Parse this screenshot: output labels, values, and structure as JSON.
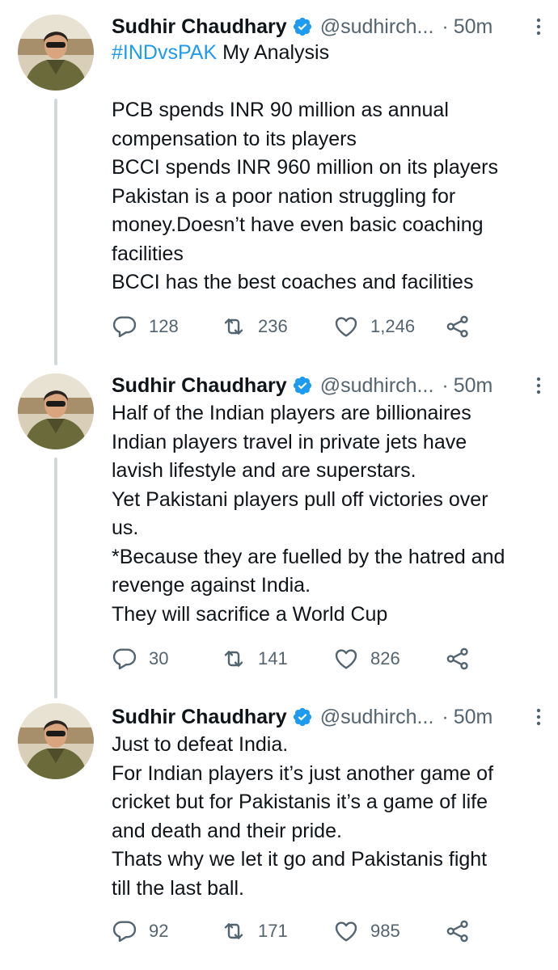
{
  "tweets": [
    {
      "author": {
        "name": "Sudhir Chaudhary",
        "handle": "@sudhirch...",
        "separator": "·",
        "time": "50m"
      },
      "hashtag": "#INDvsPAK",
      "text_after_hashtag": " My Analysis\n\nPCB spends INR 90 million as annual\ncompensation to its players\nBCCI spends INR 960 million on its players\nPakistan is a poor nation struggling for\nmoney.Doesn’t have even basic coaching\nfacilities\nBCCI has the best coaches and facilities",
      "replies": "128",
      "retweets": "236",
      "likes": "1,246"
    },
    {
      "author": {
        "name": "Sudhir Chaudhary",
        "handle": "@sudhirch...",
        "separator": "·",
        "time": "50m"
      },
      "text": "Half of the Indian players are billionaires\nIndian players travel in private jets have\nlavish lifestyle and are superstars.\nYet Pakistani players pull off victories over\nus.\n*Because they are fuelled by the hatred and\nrevenge against India.\nThey will sacrifice a World Cup",
      "replies": "30",
      "retweets": "141",
      "likes": "826"
    },
    {
      "author": {
        "name": "Sudhir Chaudhary",
        "handle": "@sudhirch...",
        "separator": "·",
        "time": "50m"
      },
      "text": "Just to defeat India.\nFor Indian players it’s just another game of\ncricket but for Pakistanis it’s a game of life\nand death and their pride.\nThats why we let it go and Pakistanis fight\ntill the last ball.",
      "replies": "92",
      "retweets": "171",
      "likes": "985"
    }
  ],
  "icons": {
    "verified": "verified-badge-icon",
    "more": "more-vertical-icon",
    "reply": "reply-bubble-icon",
    "retweet": "retweet-icon",
    "like": "heart-icon",
    "share": "share-nodes-icon"
  },
  "colors": {
    "text": "#0f1419",
    "secondary": "#536471",
    "hashtag": "#1d9bf0",
    "verified": "#1d9bf0",
    "thread_line": "#cfd9de"
  }
}
